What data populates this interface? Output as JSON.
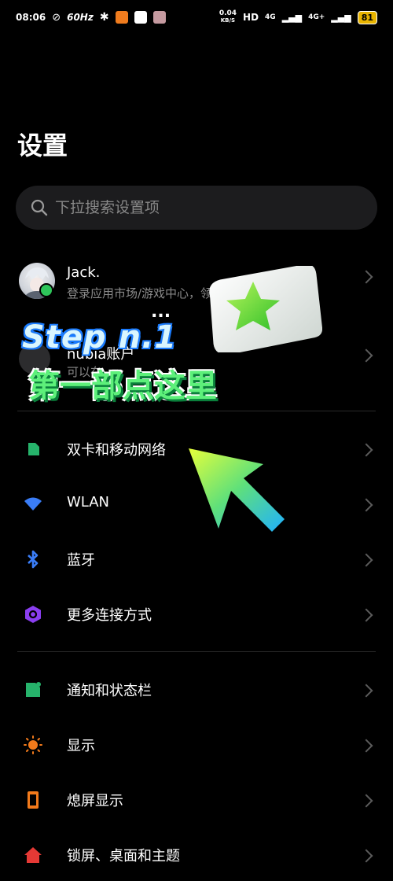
{
  "status_bar": {
    "time": "08:06",
    "refresh_rate": "60Hz",
    "net_speed_value": "0.04",
    "net_speed_unit": "KB/S",
    "hd": "HD",
    "signal1": "4G",
    "signal2": "4G+",
    "battery": "81"
  },
  "page": {
    "title": "设置"
  },
  "search": {
    "placeholder": "下拉搜索设置项"
  },
  "account": {
    "name": "Jack.",
    "subtitle": "登录应用市场/游戏中心，领",
    "second_name": "nubia账户",
    "second_subtitle": "可以在"
  },
  "overlay": {
    "step_text": "Step n.1",
    "dots": "...",
    "main_text": "第一部点这里"
  },
  "items": [
    {
      "label": "双卡和移动网络",
      "icon": "sim-card-icon",
      "color": "#26b36b"
    },
    {
      "label": "WLAN",
      "icon": "wifi-icon",
      "color": "#3a7df7"
    },
    {
      "label": "蓝牙",
      "icon": "bluetooth-icon",
      "color": "#3a7df7"
    },
    {
      "label": "更多连接方式",
      "icon": "hexagon-icon",
      "color": "#8a3ef0"
    },
    {
      "label": "通知和状态栏",
      "icon": "notification-icon",
      "color": "#26b36b"
    },
    {
      "label": "显示",
      "icon": "sun-icon",
      "color": "#f27a1b"
    },
    {
      "label": "熄屏显示",
      "icon": "screen-off-icon",
      "color": "#f27a1b"
    },
    {
      "label": "锁屏、桌面和主题",
      "icon": "home-icon",
      "color": "#e53935"
    }
  ]
}
